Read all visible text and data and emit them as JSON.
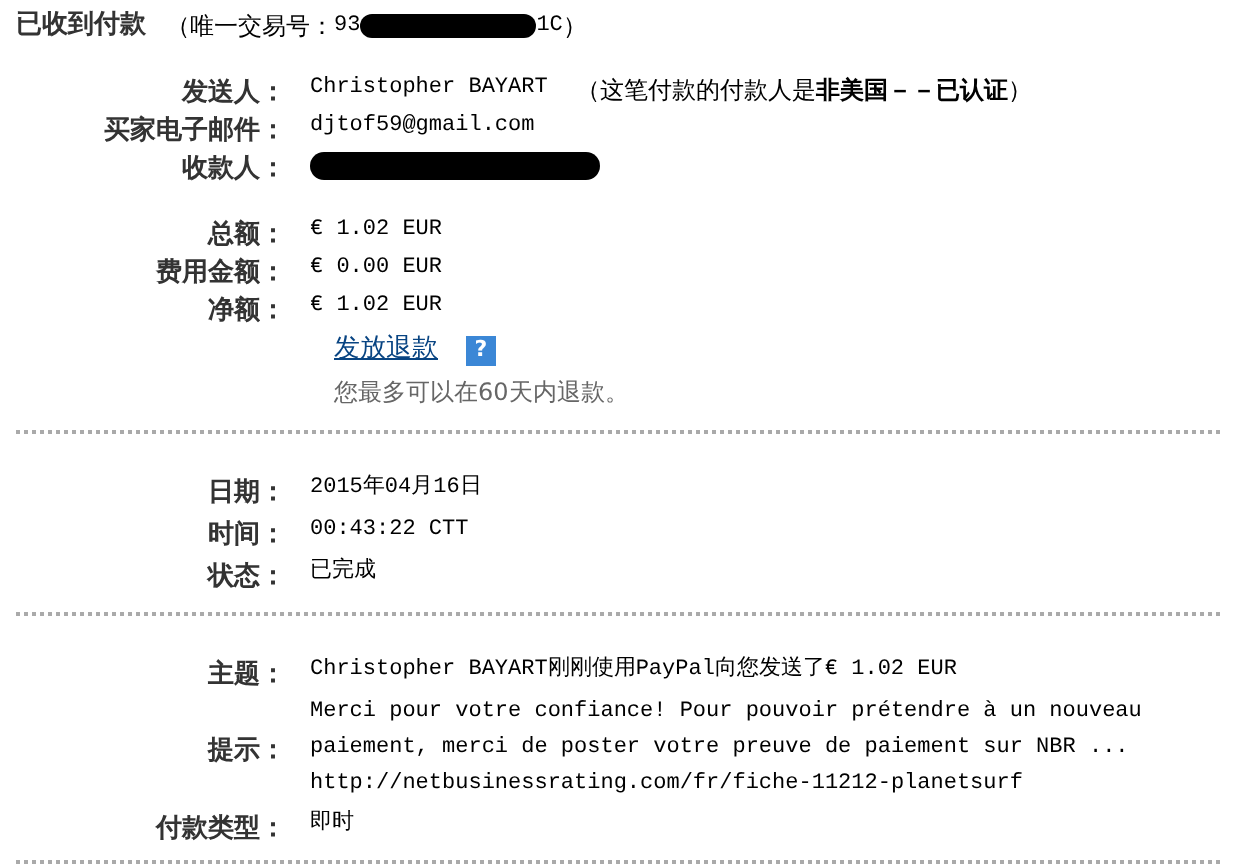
{
  "header": {
    "title": "已收到付款",
    "id_open": "（唯一交易号：",
    "id_start": "93",
    "id_end": "1C",
    "id_close": "）",
    "id_redacted": true
  },
  "section_1": [
    {
      "kind": "text",
      "label": "发送人：",
      "value": "Christopher BAYART",
      "note": "（这笔付款的付款人是**非美国－－已认证**）"
    },
    {
      "kind": "text",
      "label": "买家电子邮件：",
      "value": "djtof59@gmail.com"
    },
    {
      "kind": "redacted",
      "label": "收款人："
    },
    {
      "kind": "spacer"
    },
    {
      "kind": "text",
      "label": "总额：",
      "value": "€ 1.02 EUR"
    },
    {
      "kind": "text",
      "label": "费用金额：",
      "value": "€ 0.00 EUR"
    },
    {
      "kind": "text",
      "label": "净额：",
      "value": "€ 1.02 EUR"
    }
  ],
  "refund": {
    "link": "发放退款",
    "help": "?",
    "note": "您最多可以在60天内退款。"
  },
  "section_2": [
    {
      "kind": "text",
      "label": "日期：",
      "value": "2015年04月16日"
    },
    {
      "kind": "text",
      "label": "时间：",
      "value": "00:43:22 CTT"
    },
    {
      "kind": "text",
      "label": "状态：",
      "value": "已完成"
    }
  ],
  "section_3": [
    {
      "kind": "text",
      "label": "主题：",
      "value": "Christopher BAYART刚刚使用PayPal向您发送了€ 1.02 EUR"
    },
    {
      "kind": "multiline",
      "label": "提示：",
      "lines": [
        "Merci pour votre confiance! Pour pouvoir prétendre à un nouveau",
        "paiement, merci de poster votre preuve de paiement sur NBR ...",
        "http://netbusinessrating.com/fr/fiche-11212-planetsurf"
      ]
    },
    {
      "kind": "text",
      "label": "付款类型：",
      "value": "即时"
    }
  ]
}
